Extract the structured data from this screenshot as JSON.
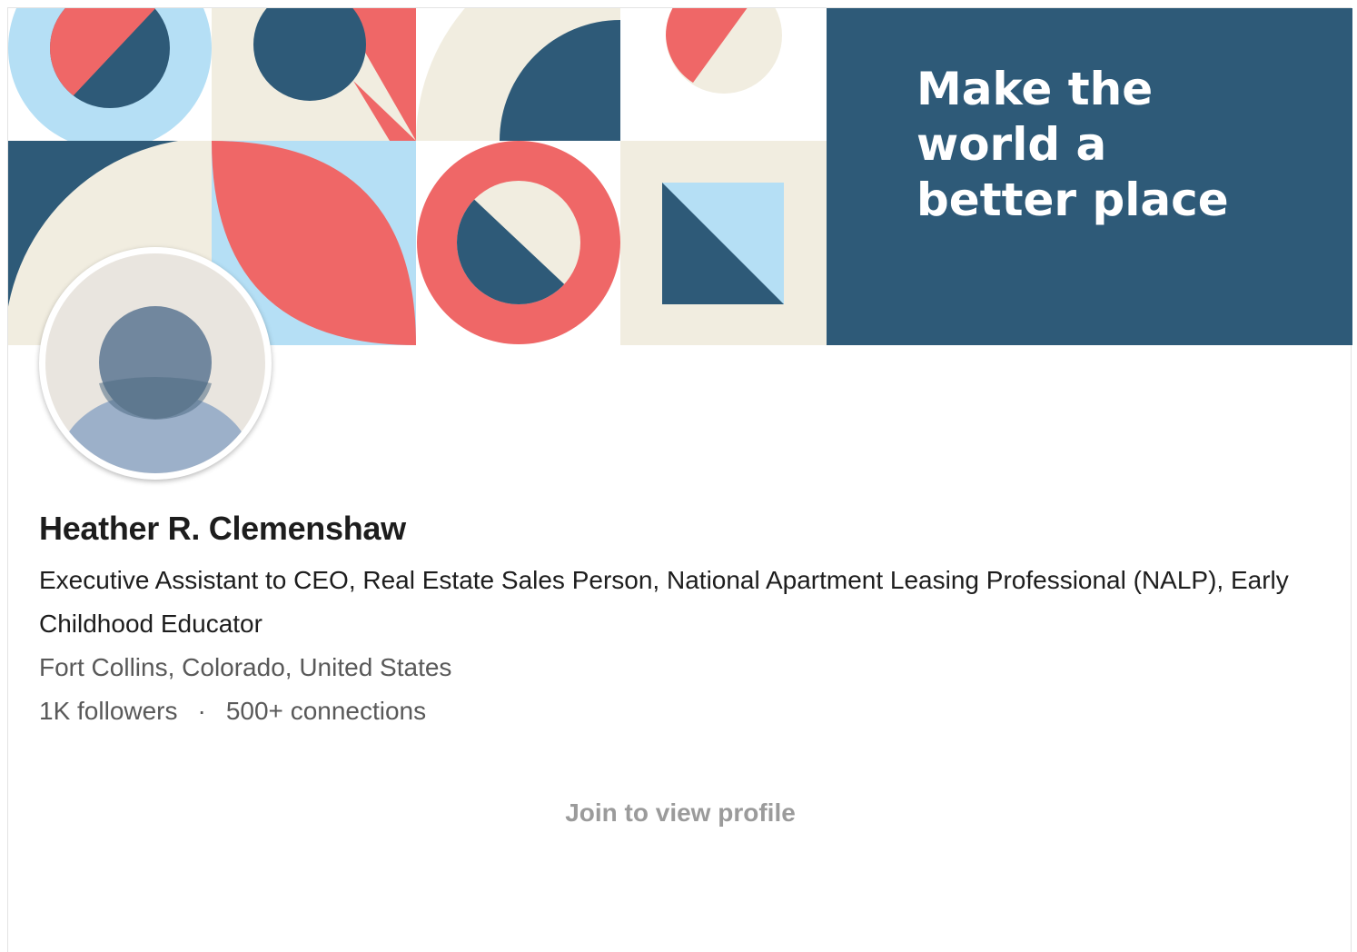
{
  "banner": {
    "tagline_lines": [
      "Make the",
      "world a",
      "better place"
    ],
    "colors": {
      "navy": "#2e5a78",
      "coral": "#ef6767",
      "light_blue": "#b5dff5",
      "cream": "#f1ede0"
    }
  },
  "profile": {
    "avatar_icon": "default-person-avatar",
    "name": "Heather R. Clemenshaw",
    "headline": "Executive Assistant to CEO, Real Estate Sales Person, National Apartment Leasing Professional (NALP), Early Childhood Educator",
    "location": "Fort Collins, Colorado, United States",
    "followers": "1K followers",
    "separator": "·",
    "connections": "500+ connections"
  },
  "cta": {
    "join_label": "Join to view profile"
  }
}
